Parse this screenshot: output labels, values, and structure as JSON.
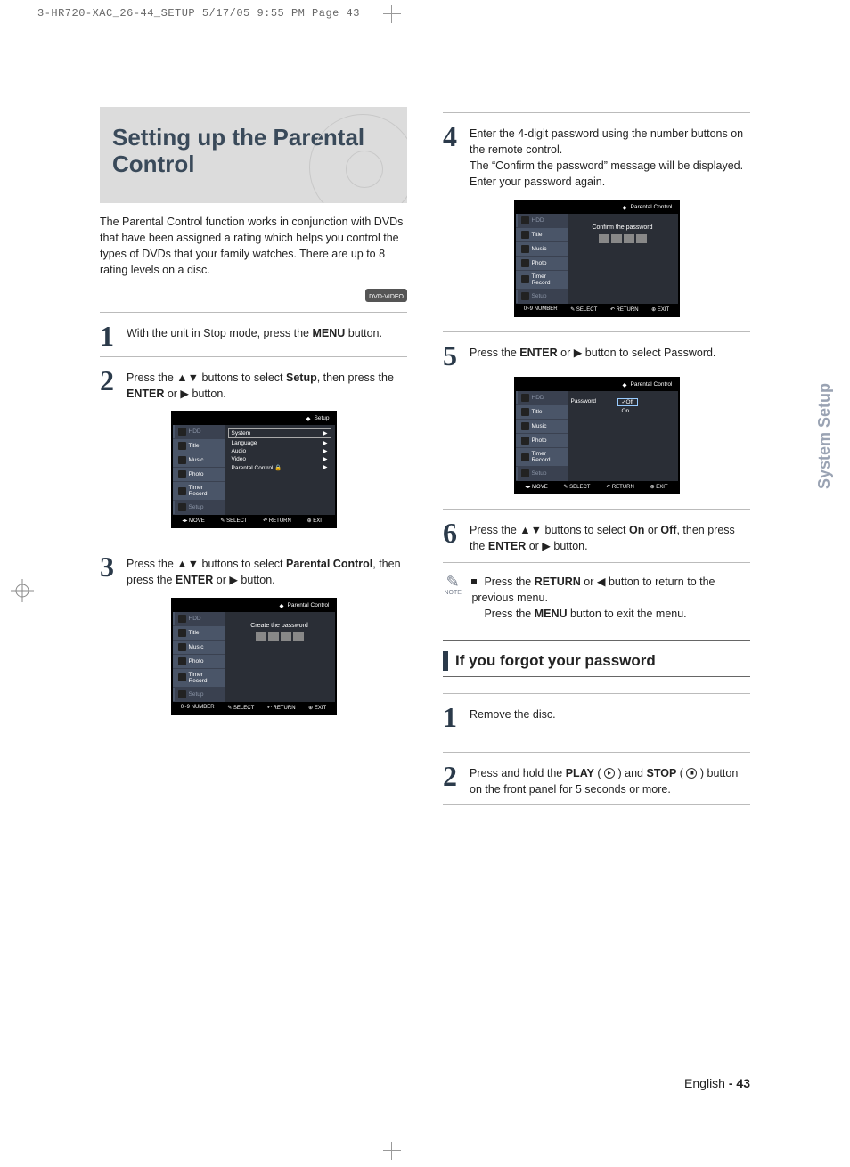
{
  "crop_header": "3-HR720-XAC_26-44_SETUP  5/17/05  9:55 PM  Page 43",
  "title": "Setting up the Parental Control",
  "intro": "The Parental Control function works in conjunction with DVDs that have been assigned a rating which helps you control the types of DVDs that your family watches. There are up to 8 rating levels on a disc.",
  "dvd_badge": "DVD-VIDEO",
  "steps": {
    "s1": {
      "num": "1",
      "pre": "With the unit in Stop mode, press the ",
      "b1": "MENU",
      "post": " button."
    },
    "s2": {
      "num": "2",
      "pre": "Press the ▲▼ buttons to select ",
      "b1": "Setup",
      "mid": ", then press the ",
      "b2": "ENTER",
      "post": " or ▶ button."
    },
    "s3": {
      "num": "3",
      "pre": "Press the ▲▼ buttons to select ",
      "b1": "Parental Control",
      "mid": ", then press the ",
      "b2": "ENTER",
      "post": " or ▶ button."
    },
    "s4": {
      "num": "4",
      "line1": "Enter the 4-digit password using the number buttons on the remote control.",
      "line2": "The “Confirm the password” message will be displayed. Enter your password again."
    },
    "s5": {
      "num": "5",
      "pre": "Press the ",
      "b1": "ENTER",
      "post": " or ▶ button to select Password."
    },
    "s6": {
      "num": "6",
      "pre": "Press the ▲▼ buttons to select ",
      "b1": "On",
      "mid": " or ",
      "b2": "Off",
      "mid2": ", then press the ",
      "b3": "ENTER",
      "post": " or ▶ button."
    }
  },
  "note": {
    "label": "NOTE",
    "pre": "Press the ",
    "b1": "RETURN",
    "mid1": " or ◀ button to return to the previous menu.",
    "line2a": "Press the ",
    "b2": "MENU",
    "line2b": " button to exit the menu."
  },
  "forgot": {
    "heading": "If you forgot your password",
    "s1": {
      "num": "1",
      "txt": "Remove the disc."
    },
    "s2": {
      "num": "2",
      "pre": "Press and hold the ",
      "b1": "PLAY",
      "paren1": " ( ",
      "icon1": "▸",
      "paren1b": " ) ",
      "mid": "and ",
      "b2": "STOP",
      "paren2": " ( ",
      "icon2": "■",
      "paren2b": " ) ",
      "post": "button on the front panel for 5 seconds or more."
    }
  },
  "osd": {
    "menu_setup": {
      "crumb": "Setup",
      "side": [
        "HDD",
        "Title",
        "Music",
        "Photo",
        "Timer Record",
        "Setup"
      ],
      "rows": [
        "System",
        "Language",
        "Audio",
        "Video",
        "Parental Control"
      ],
      "footer": [
        "◂▸ MOVE",
        "✎ SELECT",
        "↶ RETURN",
        "⊕ EXIT"
      ]
    },
    "menu_create": {
      "crumb": "Parental Control",
      "prompt": "Create the password",
      "footer": [
        "0~9 NUMBER",
        "✎ SELECT",
        "↶ RETURN",
        "⊕ EXIT"
      ]
    },
    "menu_confirm": {
      "crumb": "Parental Control",
      "prompt": "Confirm the password",
      "footer": [
        "0~9 NUMBER",
        "✎ SELECT",
        "↶ RETURN",
        "⊕ EXIT"
      ]
    },
    "menu_password": {
      "crumb": "Parental Control",
      "label": "Password",
      "off": "Off",
      "on": "On",
      "footer": [
        "◂▸ MOVE",
        "✎ SELECT",
        "↶ RETURN",
        "⊕ EXIT"
      ]
    }
  },
  "side_tab": "System Setup",
  "page_footer": {
    "lang": "English",
    "sep": " - ",
    "num": "43"
  }
}
